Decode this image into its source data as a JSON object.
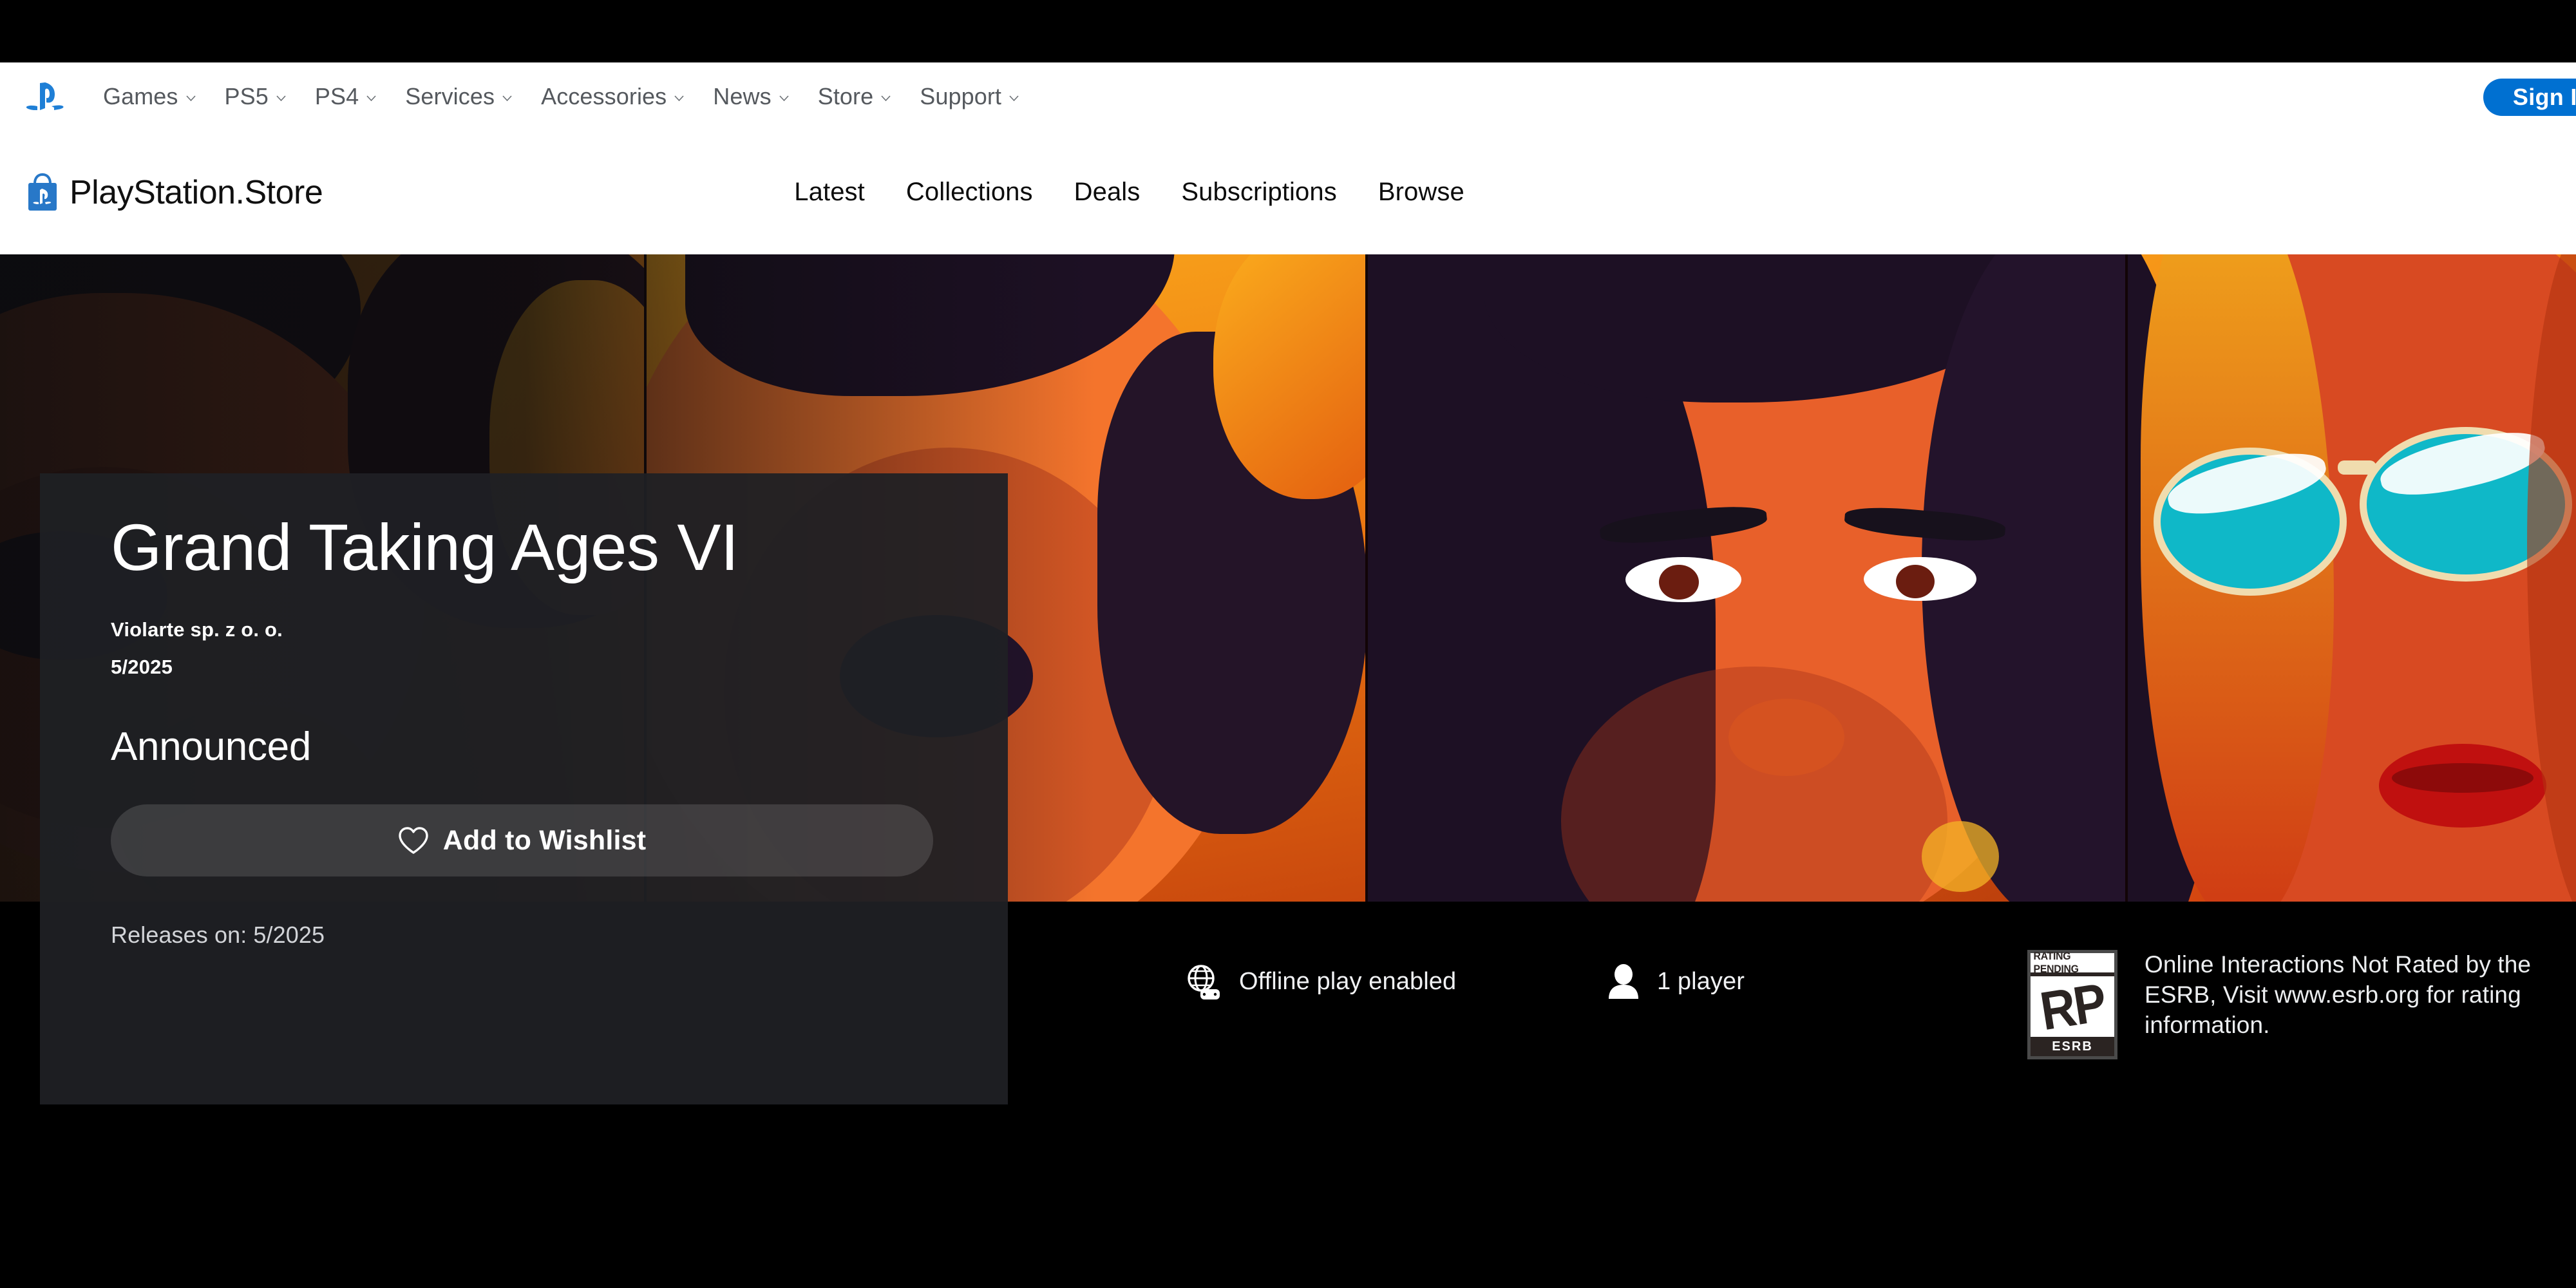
{
  "global_nav": {
    "logo_icon": "playstation-logo-icon",
    "links": [
      {
        "label": "Games",
        "icon": "chevron-down-icon"
      },
      {
        "label": "PS5",
        "icon": "chevron-down-icon"
      },
      {
        "label": "PS4",
        "icon": "chevron-down-icon"
      },
      {
        "label": "Services",
        "icon": "chevron-down-icon"
      },
      {
        "label": "Accessories",
        "icon": "chevron-down-icon"
      },
      {
        "label": "News",
        "icon": "chevron-down-icon"
      },
      {
        "label": "Store",
        "icon": "chevron-down-icon"
      },
      {
        "label": "Support",
        "icon": "chevron-down-icon"
      }
    ],
    "sign_in_label": "Sign In",
    "sign_in_color": "#0070d1"
  },
  "store_nav": {
    "bag_icon": "store-bag-icon",
    "wordmark": "PlayStation",
    "wordmark_dot": ".",
    "wordmark_store": "Store",
    "links": [
      {
        "label": "Latest"
      },
      {
        "label": "Collections"
      },
      {
        "label": "Deals"
      },
      {
        "label": "Subscriptions"
      },
      {
        "label": "Browse"
      }
    ]
  },
  "product": {
    "title": "Grand Taking Ages VI",
    "publisher": "Violarte sp. z o. o.",
    "release_short": "5/2025",
    "status": "Announced",
    "wishlist_label": "Add to Wishlist",
    "wishlist_icon": "heart-icon",
    "releases_on": "Releases on: 5/2025"
  },
  "features": [
    {
      "icon": "globe-controller-icon",
      "label": "Offline play enabled"
    },
    {
      "icon": "person-icon",
      "label": "1 player"
    }
  ],
  "rating": {
    "badge_top": "RATING PENDING",
    "badge_letters": "RP",
    "badge_bottom": "ESRB",
    "disclaimer": "Online Interactions Not Rated by the ESRB, Visit www.esrb.org for rating information."
  }
}
